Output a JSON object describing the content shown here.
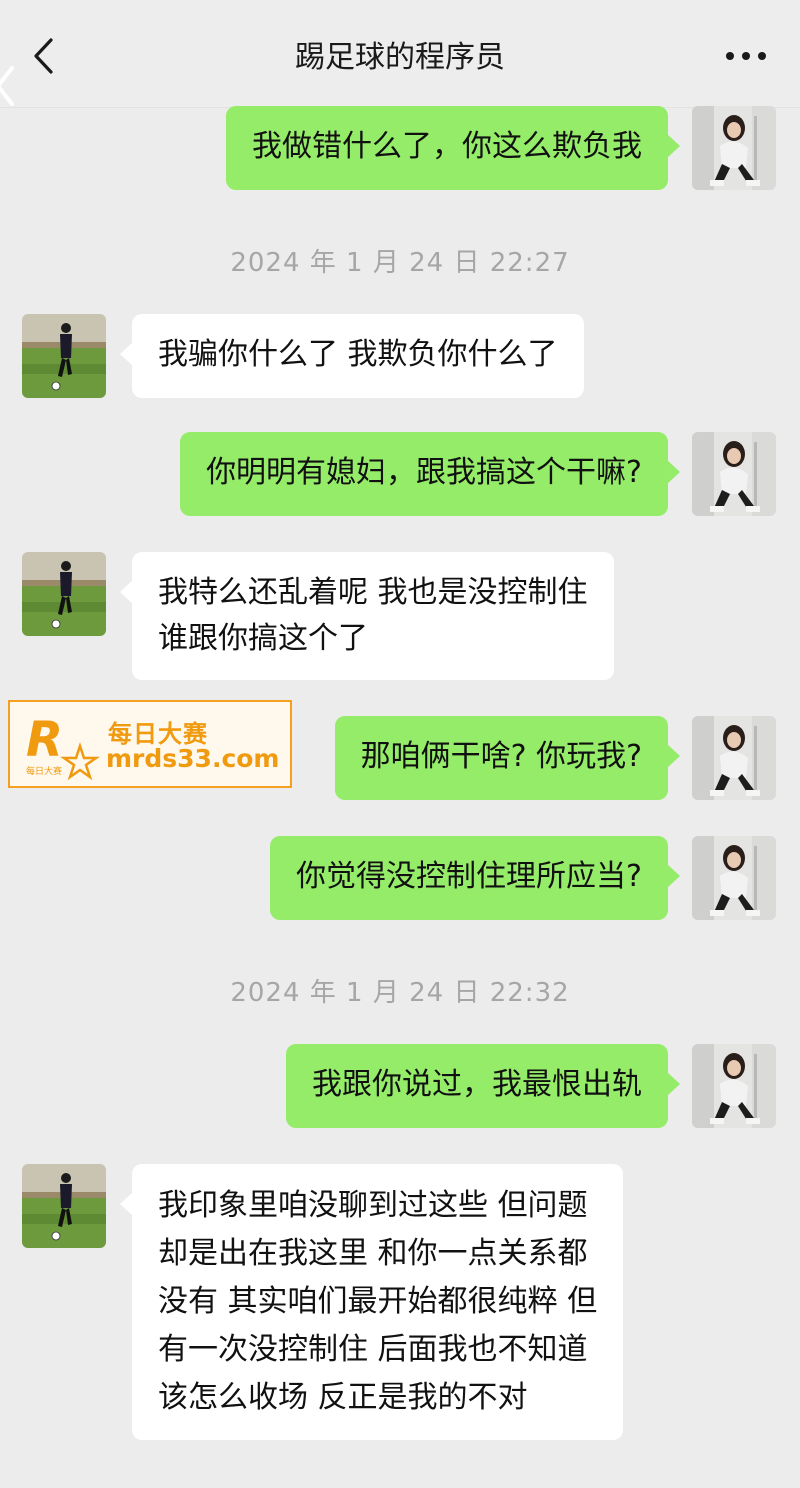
{
  "header": {
    "title": "踢足球的程序员",
    "back_icon": "chevron-left-icon",
    "more_icon": "more-dots-icon"
  },
  "colors": {
    "sent_bubble": "#95ec69",
    "received_bubble": "#ffffff",
    "background": "#ececec",
    "timestamp_text": "#a6a6a6",
    "watermark_accent": "#f09a10"
  },
  "messages": [
    {
      "side": "sent",
      "text": "我做错什么了，你这么欺负我"
    },
    {
      "side": "timestamp",
      "text": "2024 年 1 月 24 日  22:27"
    },
    {
      "side": "received",
      "text": "我骗你什么了 我欺负你什么了"
    },
    {
      "side": "sent",
      "text": "你明明有媳妇，跟我搞这个干嘛?"
    },
    {
      "side": "received",
      "lines": [
        "我特么还乱着呢 我也是没控制住",
        "谁跟你搞这个了"
      ]
    },
    {
      "side": "sent",
      "text": "那咱俩干啥? 你玩我?"
    },
    {
      "side": "sent",
      "text": "你觉得没控制住理所应当?"
    },
    {
      "side": "timestamp",
      "text": "2024 年 1 月 24 日  22:32"
    },
    {
      "side": "sent",
      "text": "我跟你说过，我最恨出轨"
    },
    {
      "side": "received",
      "lines": [
        "我印象里咱没聊到过这些 但问题",
        "却是出在我这里 和你一点关系都",
        "没有 其实咱们最开始都很纯粹 但",
        "有一次没控制住 后面我也不知道",
        "该怎么收场 反正是我的不对"
      ]
    }
  ],
  "watermark": {
    "logo_letter": "R",
    "logo_sub": "每日大赛",
    "name": "每日大赛",
    "url": "mrds33.com"
  }
}
